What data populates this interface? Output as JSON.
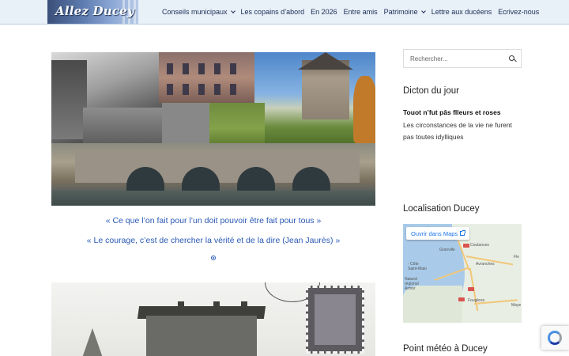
{
  "header": {
    "logo_text": "Allez Ducey",
    "nav": [
      {
        "label": "Conseils municipaux",
        "has_dropdown": true
      },
      {
        "label": "Les copains d’abord",
        "has_dropdown": false
      },
      {
        "label": "En 2026",
        "has_dropdown": false
      },
      {
        "label": "Entre amis",
        "has_dropdown": false
      },
      {
        "label": "Patrimoine",
        "has_dropdown": true
      },
      {
        "label": "Lettre aux ducéens",
        "has_dropdown": false
      },
      {
        "label": "Ecrivez-nous",
        "has_dropdown": false
      }
    ]
  },
  "main": {
    "quotes": [
      "« Ce que l’on fait pour l’un doit pouvoir être fait pour tous »",
      "« Le courage, c’est de chercher la vérité et de la dire (Jean Jaurès) »"
    ]
  },
  "sidebar": {
    "search": {
      "placeholder": "Rechercher..."
    },
    "dicton": {
      "title": "Dicton du jour",
      "saying": "Touot n’fut pâs flleurs et roses",
      "meaning": "Les circonstances de la vie ne furent pas toutes idylliques"
    },
    "localisation": {
      "title": "Localisation Ducey",
      "open_maps_label": "Ouvrir dans Maps",
      "map_labels": [
        "Coutances",
        "Granville",
        "Avranches",
        "Saint-Malo",
        "Fougères",
        "Fle",
        "Maye",
        "- Côte",
        "Naturel",
        "régional",
        "Armor"
      ]
    },
    "meteo": {
      "title": "Point météo à Ducey"
    }
  },
  "colors": {
    "accent_blue": "#2a59b5",
    "header_bg": "#e8f0f8",
    "nav_text": "#1a2c55"
  }
}
